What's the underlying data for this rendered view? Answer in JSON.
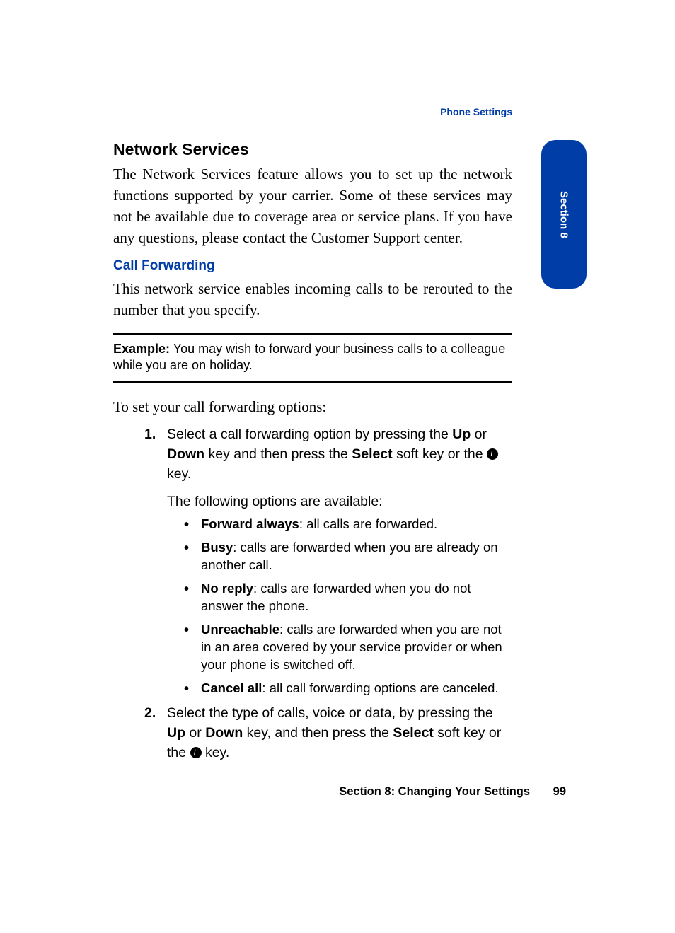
{
  "header": {
    "label": "Phone Settings"
  },
  "sideTab": {
    "label": "Section 8"
  },
  "h1": "Network Services",
  "intro": "The Network Services feature allows you to set up the network functions supported by your carrier. Some of these services may not be available due to coverage area or service plans. If you have any questions, please contact the Customer Support center.",
  "sub1": "Call Forwarding",
  "sub1_text": "This network service enables incoming calls to be rerouted to the number that you specify.",
  "example_label": "Example:",
  "example_text": " You may wish to forward your business calls to a colleague while you are on holiday.",
  "lead": "To set your call forwarding options:",
  "step1": {
    "pre": "Select a call forwarding option by pressing the ",
    "b1": "Up",
    "mid1": " or ",
    "b2": "Down",
    "mid2": " key and then press the ",
    "b3": "Select",
    "mid3": " soft key or the ",
    "post": " key.",
    "para": "The following options are available:",
    "opts": [
      {
        "name": "Forward always",
        "desc": ": all calls are forwarded."
      },
      {
        "name": "Busy",
        "desc": ": calls are forwarded when you are already on another call."
      },
      {
        "name": "No reply",
        "desc": ": calls are forwarded when you do not answer the phone."
      },
      {
        "name": "Unreachable",
        "desc": ": calls are forwarded when you are not in an area covered by your service provider or when your phone is switched off."
      },
      {
        "name": "Cancel all",
        "desc": ": all call forwarding options are canceled."
      }
    ]
  },
  "step2": {
    "pre": "Select the type of calls, voice or data, by pressing the ",
    "b1": "Up",
    "mid1": " or ",
    "b2": "Down",
    "mid2": " key, and then press the ",
    "b3": "Select",
    "mid3": " soft key or the ",
    "post": " key."
  },
  "footer": {
    "label": "Section 8: Changing Your Settings",
    "page": "99"
  }
}
